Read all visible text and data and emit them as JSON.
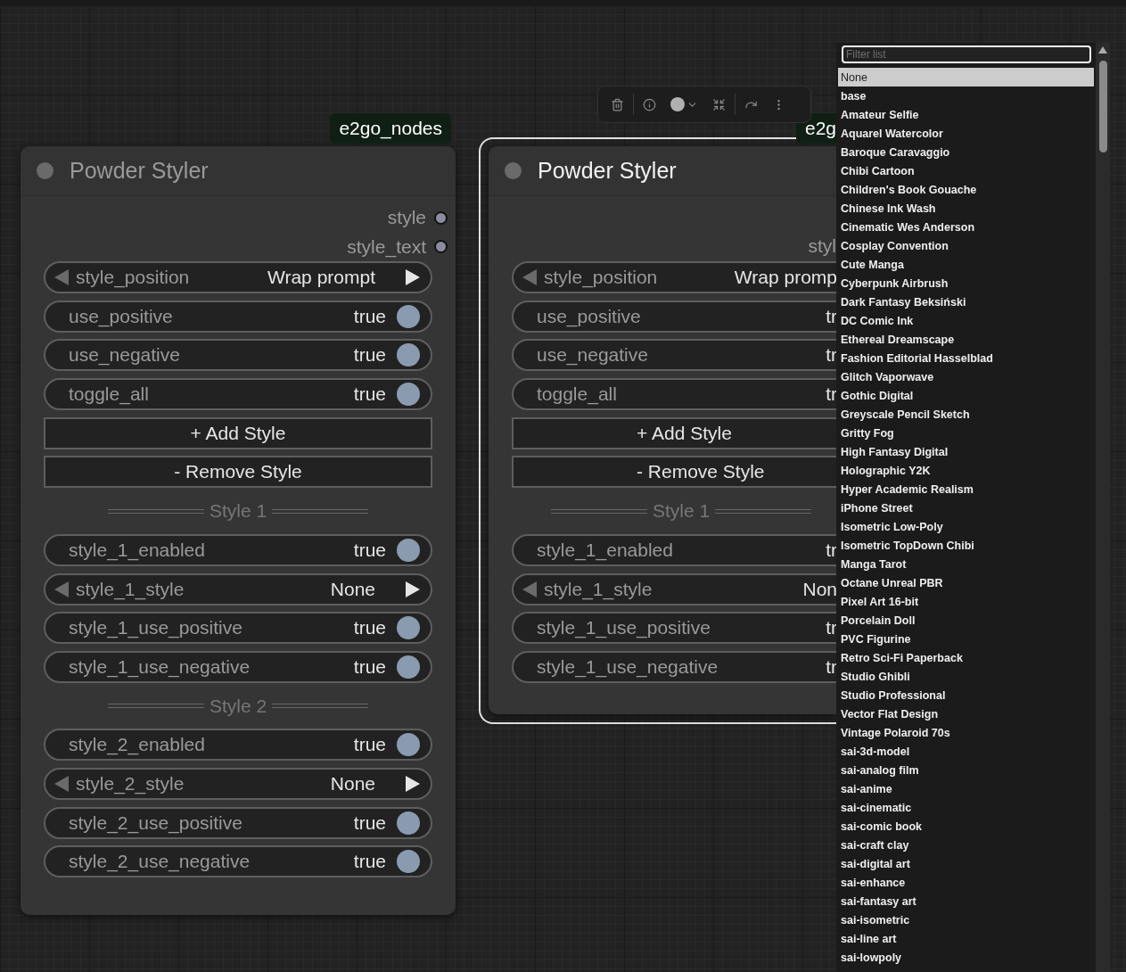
{
  "nodes": [
    {
      "badge": "e2go_nodes",
      "title": "Powder Styler",
      "selected": false,
      "outputs": [
        {
          "label": "style"
        },
        {
          "label": "style_text"
        }
      ],
      "widgets": [
        {
          "kind": "combo",
          "label": "style_position",
          "value": "Wrap prompt"
        },
        {
          "kind": "toggle",
          "label": "use_positive",
          "value": "true",
          "on": true
        },
        {
          "kind": "toggle",
          "label": "use_negative",
          "value": "true",
          "on": true
        },
        {
          "kind": "toggle",
          "label": "toggle_all",
          "value": "true",
          "on": true
        },
        {
          "kind": "button",
          "label": "+ Add Style"
        },
        {
          "kind": "button",
          "label": "- Remove Style"
        },
        {
          "kind": "section",
          "label": "Style 1"
        },
        {
          "kind": "toggle",
          "label": "style_1_enabled",
          "value": "true",
          "on": true
        },
        {
          "kind": "combo",
          "label": "style_1_style",
          "value": "None"
        },
        {
          "kind": "toggle",
          "label": "style_1_use_positive",
          "value": "true",
          "on": true
        },
        {
          "kind": "toggle",
          "label": "style_1_use_negative",
          "value": "true",
          "on": true
        },
        {
          "kind": "section",
          "label": "Style 2"
        },
        {
          "kind": "toggle",
          "label": "style_2_enabled",
          "value": "true",
          "on": true
        },
        {
          "kind": "combo",
          "label": "style_2_style",
          "value": "None"
        },
        {
          "kind": "toggle",
          "label": "style_2_use_positive",
          "value": "true",
          "on": true
        },
        {
          "kind": "toggle",
          "label": "style_2_use_negative",
          "value": "true",
          "on": true
        }
      ]
    },
    {
      "badge": "e2g",
      "title": "Powder Styler",
      "selected": true,
      "outputs": [
        {
          "label": "styl"
        }
      ],
      "widgets": [
        {
          "kind": "combo",
          "label": "style_position",
          "value": "Wrap promp"
        },
        {
          "kind": "toggle",
          "label": "use_positive",
          "value": "tr"
        },
        {
          "kind": "toggle",
          "label": "use_negative",
          "value": "tr"
        },
        {
          "kind": "toggle",
          "label": "toggle_all",
          "value": "tr"
        },
        {
          "kind": "button",
          "label": "+ Add Style"
        },
        {
          "kind": "button",
          "label": "- Remove Style"
        },
        {
          "kind": "section",
          "label": "Style 1"
        },
        {
          "kind": "toggle",
          "label": "style_1_enabled",
          "value": "tr"
        },
        {
          "kind": "combo",
          "label": "style_1_style",
          "value": "Non"
        },
        {
          "kind": "toggle",
          "label": "style_1_use_positive",
          "value": "tr"
        },
        {
          "kind": "toggle",
          "label": "style_1_use_negative",
          "value": "tr"
        }
      ]
    }
  ],
  "dropdown": {
    "placeholder": "Filter list",
    "items": [
      {
        "label": "None",
        "selected": true
      },
      {
        "label": "base",
        "selected": false
      },
      {
        "label": "Amateur Selfie",
        "selected": false
      },
      {
        "label": "Aquarel Watercolor",
        "selected": false
      },
      {
        "label": "Baroque Caravaggio",
        "selected": false
      },
      {
        "label": "Chibi Cartoon",
        "selected": false
      },
      {
        "label": "Children's Book Gouache",
        "selected": false
      },
      {
        "label": "Chinese Ink Wash",
        "selected": false
      },
      {
        "label": "Cinematic Wes Anderson",
        "selected": false
      },
      {
        "label": "Cosplay Convention",
        "selected": false
      },
      {
        "label": "Cute Manga",
        "selected": false
      },
      {
        "label": "Cyberpunk Airbrush",
        "selected": false
      },
      {
        "label": "Dark Fantasy Beksiński",
        "selected": false
      },
      {
        "label": "DC Comic Ink",
        "selected": false
      },
      {
        "label": "Ethereal Dreamscape",
        "selected": false
      },
      {
        "label": "Fashion Editorial Hasselblad",
        "selected": false
      },
      {
        "label": "Glitch Vaporwave",
        "selected": false
      },
      {
        "label": "Gothic Digital",
        "selected": false
      },
      {
        "label": "Greyscale Pencil Sketch",
        "selected": false
      },
      {
        "label": "Gritty Fog",
        "selected": false
      },
      {
        "label": "High Fantasy Digital",
        "selected": false
      },
      {
        "label": "Holographic Y2K",
        "selected": false
      },
      {
        "label": "Hyper Academic Realism",
        "selected": false
      },
      {
        "label": "iPhone Street",
        "selected": false
      },
      {
        "label": "Isometric Low-Poly",
        "selected": false
      },
      {
        "label": "Isometric TopDown Chibi",
        "selected": false
      },
      {
        "label": "Manga Tarot",
        "selected": false
      },
      {
        "label": "Octane Unreal PBR",
        "selected": false
      },
      {
        "label": "Pixel Art 16-bit",
        "selected": false
      },
      {
        "label": "Porcelain Doll",
        "selected": false
      },
      {
        "label": "PVC Figurine",
        "selected": false
      },
      {
        "label": "Retro Sci-Fi Paperback",
        "selected": false
      },
      {
        "label": "Studio Ghibli",
        "selected": false
      },
      {
        "label": "Studio Professional",
        "selected": false
      },
      {
        "label": "Vector Flat Design",
        "selected": false
      },
      {
        "label": "Vintage Polaroid 70s",
        "selected": false
      },
      {
        "label": "sai-3d-model",
        "selected": false
      },
      {
        "label": "sai-analog film",
        "selected": false
      },
      {
        "label": "sai-anime",
        "selected": false
      },
      {
        "label": "sai-cinematic",
        "selected": false
      },
      {
        "label": "sai-comic book",
        "selected": false
      },
      {
        "label": "sai-craft clay",
        "selected": false
      },
      {
        "label": "sai-digital art",
        "selected": false
      },
      {
        "label": "sai-enhance",
        "selected": false
      },
      {
        "label": "sai-fantasy art",
        "selected": false
      },
      {
        "label": "sai-isometric",
        "selected": false
      },
      {
        "label": "sai-line art",
        "selected": false
      },
      {
        "label": "sai-lowpoly",
        "selected": false
      }
    ]
  }
}
